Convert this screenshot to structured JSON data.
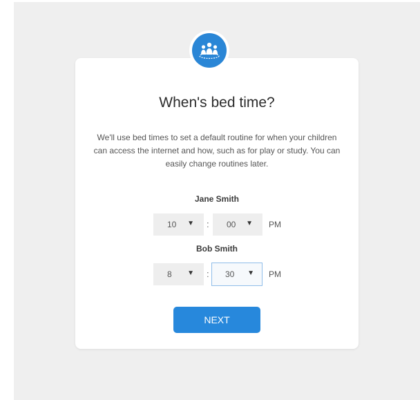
{
  "dialog": {
    "title": "When's bed time?",
    "description": "We'll use bed times to set a default routine for when your children can access the internet and how, such as for play or study. You can easily change routines later.",
    "next_label": "NEXT"
  },
  "children": [
    {
      "name": "Jane Smith",
      "hour": "10",
      "minute": "00",
      "ampm": "PM"
    },
    {
      "name": "Bob Smith",
      "hour": "8",
      "minute": "30",
      "ampm": "PM"
    }
  ],
  "separator": ":",
  "icon": "family-icon",
  "colors": {
    "accent": "#2788dc",
    "background": "#efefef"
  }
}
